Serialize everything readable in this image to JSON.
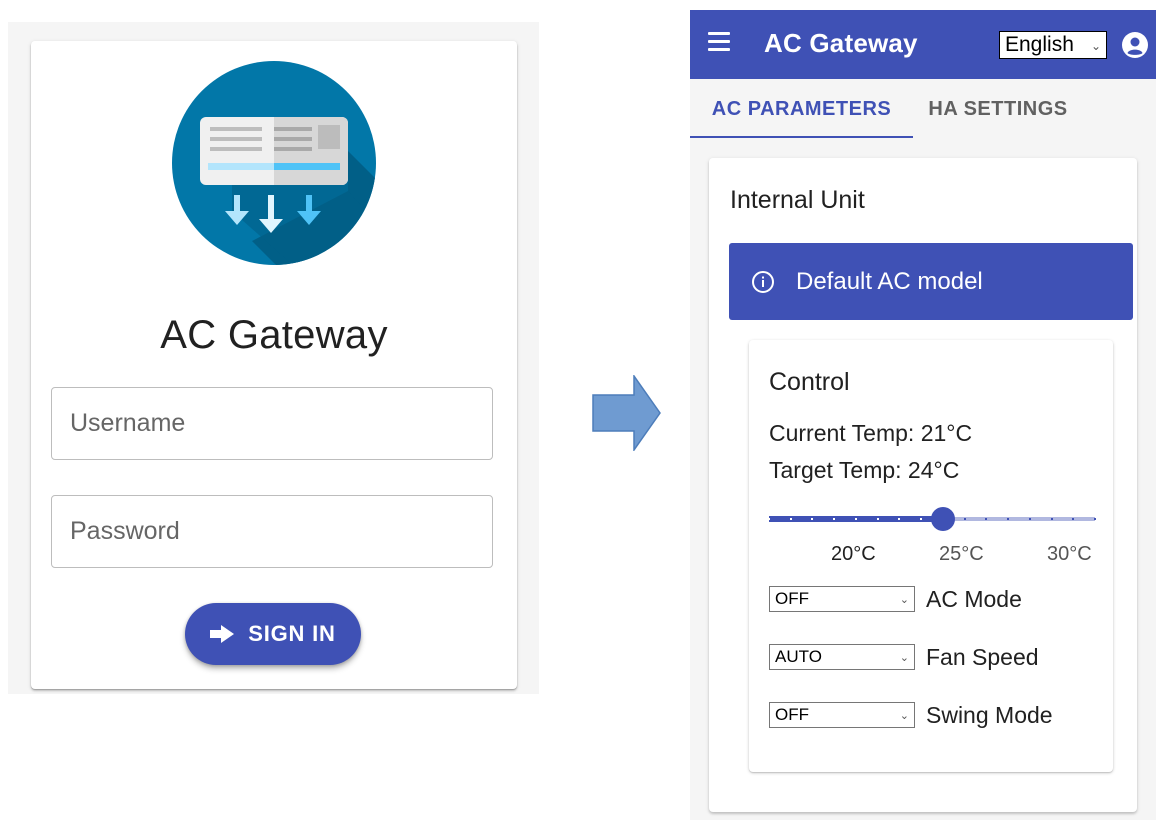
{
  "login": {
    "title": "AC Gateway",
    "username_placeholder": "Username",
    "password_placeholder": "Password",
    "signin_label": "SIGN IN"
  },
  "app": {
    "title": "AC Gateway",
    "language": "English",
    "tabs": [
      {
        "label": "AC PARAMETERS",
        "active": true
      },
      {
        "label": "HA SETTINGS",
        "active": false
      }
    ],
    "unit_title": "Internal Unit",
    "info_banner": "Default AC model",
    "control": {
      "title": "Control",
      "current_temp": "Current Temp: 21°C",
      "target_temp": "Target Temp: 24°C",
      "slider": {
        "min": 16,
        "max": 31,
        "value": 24,
        "step": 1
      },
      "tick_labels": [
        "20°C",
        "25°C",
        "30°C"
      ],
      "ac_mode_value": "OFF",
      "ac_mode_label": "AC Mode",
      "fan_speed_value": "AUTO",
      "fan_speed_label": "Fan Speed",
      "swing_mode_value": "OFF",
      "swing_mode_label": "Swing Mode"
    }
  },
  "colors": {
    "primary": "#3f51b5",
    "logo_circle": "#0277a8",
    "arrow": "#6f9bd1"
  }
}
